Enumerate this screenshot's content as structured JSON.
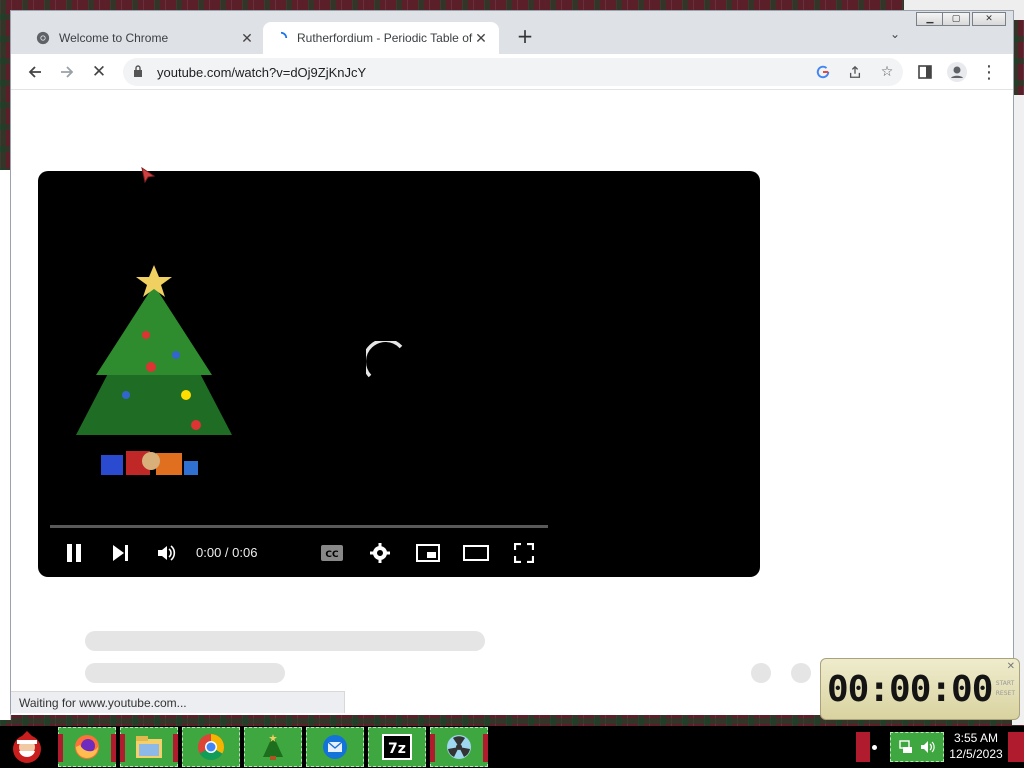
{
  "browser": {
    "tabs": [
      {
        "title": "Welcome to Chrome",
        "icon": "chrome-logo-icon",
        "active": false
      },
      {
        "title": "Rutherfordium - Periodic Table of",
        "icon": "loading-icon",
        "active": true
      }
    ],
    "new_tab_label": "+",
    "address": {
      "url": "youtube.com/watch?v=dOj9ZjKnJcY"
    },
    "status_text": "Waiting for www.youtube.com..."
  },
  "player": {
    "time_display": "0:00 / 0:06",
    "progress": 0,
    "state": "loading",
    "controls": [
      "pause-icon",
      "next-icon",
      "volume-icon",
      "cc-icon",
      "settings-icon",
      "miniplayer-icon",
      "theater-icon",
      "fullscreen-icon"
    ]
  },
  "stopwatch": {
    "display": "00:00:00",
    "side_labels": [
      "START",
      "RESET"
    ]
  },
  "taskbar": {
    "apps": [
      "santa-start-icon",
      "firefox-icon",
      "file-explorer-icon",
      "chrome-icon",
      "christmas-tree-icon",
      "thunderbird-icon",
      "7zip-icon",
      "app-icon"
    ],
    "clock_time": "3:55 AM",
    "clock_date": "12/5/2023"
  },
  "colors": {
    "taskbar_button": "#3fa73f",
    "taskbar_accent": "#b01c2e",
    "player_bg": "#000000",
    "stopwatch_bg": "#e6e1b6"
  }
}
